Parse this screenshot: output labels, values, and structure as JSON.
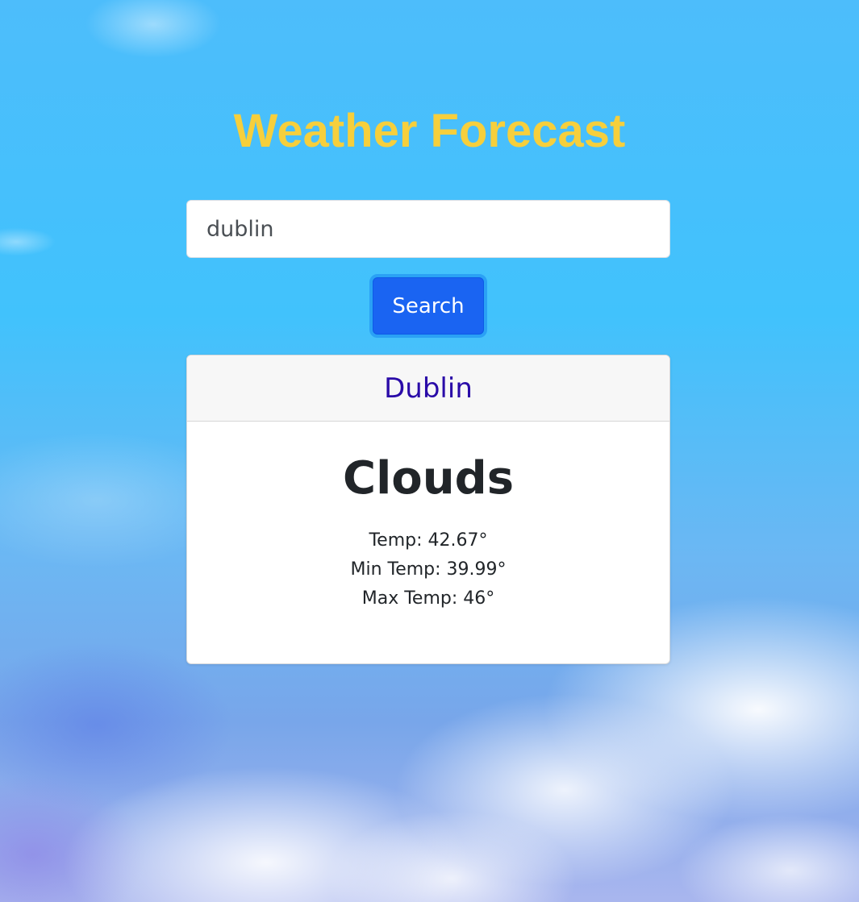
{
  "app": {
    "title": "Weather Forecast"
  },
  "search": {
    "value": "dublin",
    "button_label": "Search"
  },
  "result": {
    "city": "Dublin",
    "condition": "Clouds",
    "temp": "Temp: 42.67°",
    "min_temp": "Min Temp: 39.99°",
    "max_temp": "Max Temp: 46°"
  },
  "colors": {
    "title": "#f6cf3c",
    "button": "#1a64f2",
    "city": "#2a0ba8",
    "sky": "#3ec0fb"
  }
}
